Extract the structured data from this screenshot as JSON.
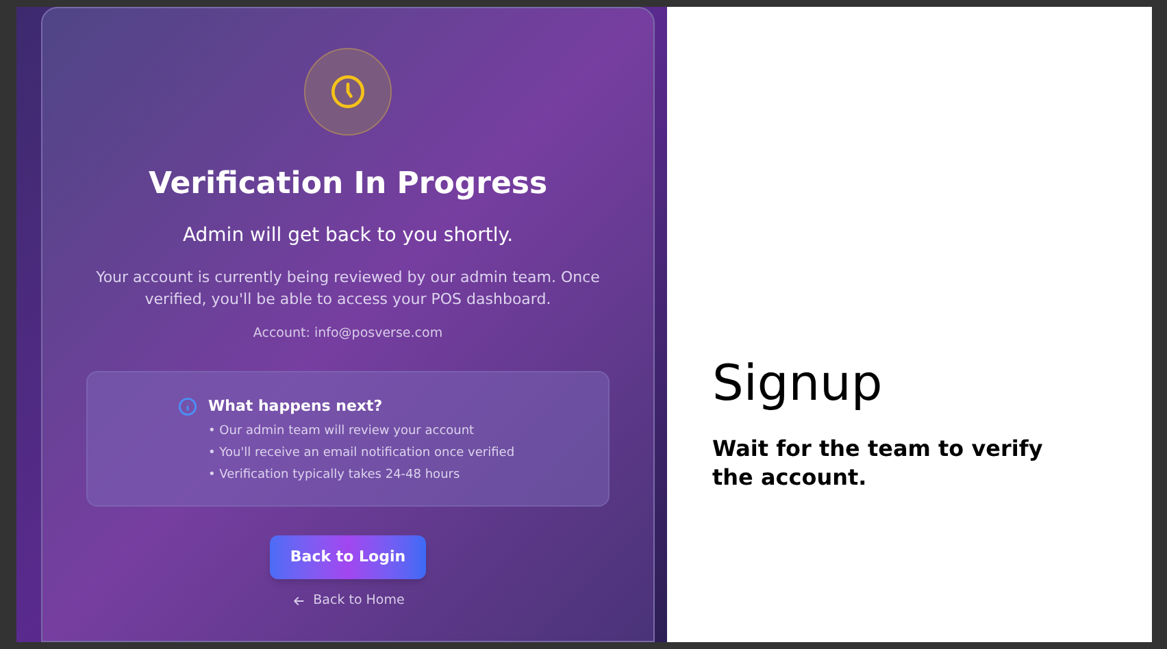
{
  "card": {
    "title": "Verification In Progress",
    "subtitle": "Admin will get back to you shortly.",
    "description": "Your account is currently being reviewed by our admin team. Once verified, you'll be able to access your POS dashboard.",
    "account": "Account: info@posverse.com",
    "info": {
      "heading": "What happens next?",
      "items": [
        "• Our admin team will review your account",
        "• You'll receive an email notification once verified",
        "• Verification typically takes 24-48 hours"
      ]
    },
    "primary_button": "Back to Login",
    "back_link": "Back to Home"
  },
  "side": {
    "title": "Signup",
    "caption": "Wait for the team to verify the account."
  }
}
